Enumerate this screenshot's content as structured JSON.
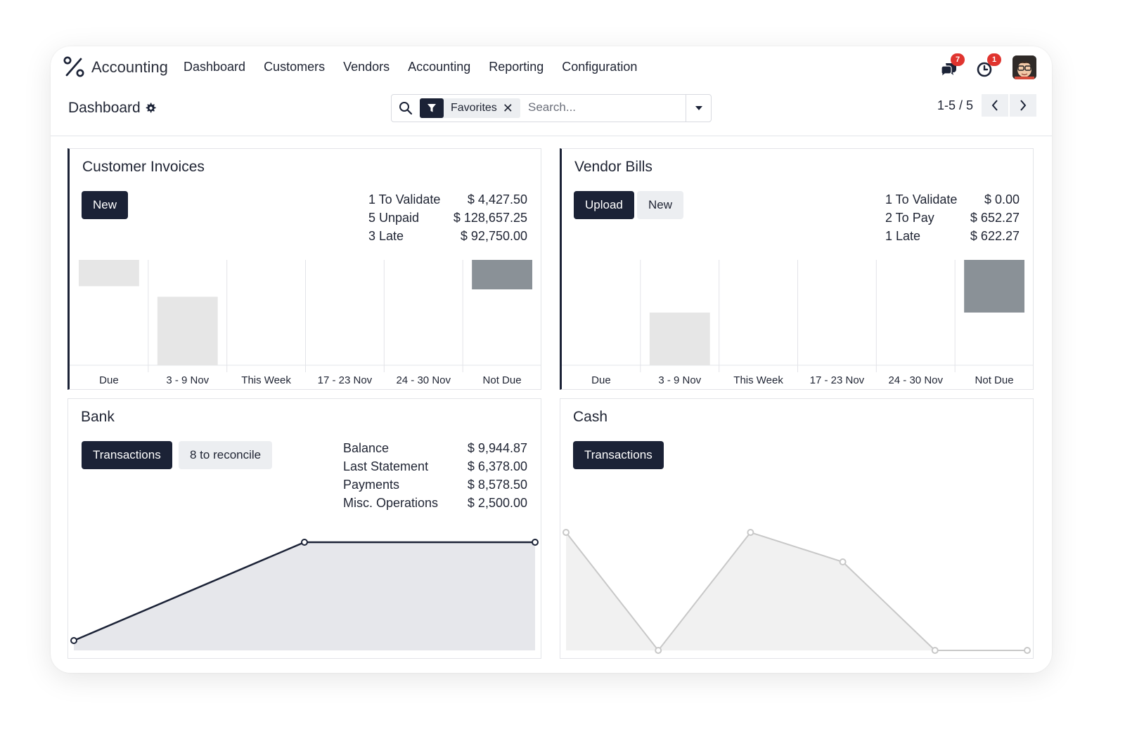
{
  "app": {
    "name": "Accounting",
    "menu": [
      "Dashboard",
      "Customers",
      "Vendors",
      "Accounting",
      "Reporting",
      "Configuration"
    ],
    "messages_badge": "7",
    "activities_badge": "1"
  },
  "control": {
    "breadcrumb": "Dashboard",
    "facet_label": "Favorites",
    "facet_remove": "✕",
    "search_placeholder": "Search...",
    "pager": "1-5 / 5"
  },
  "customer_invoices": {
    "title": "Customer Invoices",
    "buttons": {
      "new": "New"
    },
    "stats": [
      {
        "label": "1 To Validate",
        "value": "$ 4,427.50"
      },
      {
        "label": "5 Unpaid",
        "value": "$ 128,657.25"
      },
      {
        "label": "3 Late",
        "value": "$ 92,750.00"
      }
    ]
  },
  "vendor_bills": {
    "title": "Vendor Bills",
    "buttons": {
      "upload": "Upload",
      "new": "New"
    },
    "stats": [
      {
        "label": "1 To Validate",
        "value": "$ 0.00"
      },
      {
        "label": "2 To Pay",
        "value": "$ 652.27"
      },
      {
        "label": "1 Late",
        "value": "$ 622.27"
      }
    ]
  },
  "bank": {
    "title": "Bank",
    "buttons": {
      "transactions": "Transactions",
      "reconcile": "8 to reconcile"
    },
    "stats": [
      {
        "label": "Balance",
        "value": "$ 9,944.87"
      },
      {
        "label": "Last Statement",
        "value": "$ 6,378.00"
      },
      {
        "label": "Payments",
        "value": "$ 8,578.50"
      },
      {
        "label": "Misc. Operations",
        "value": "$ 2,500.00"
      }
    ]
  },
  "cash": {
    "title": "Cash",
    "buttons": {
      "transactions": "Transactions"
    }
  },
  "colors": {
    "primary": "#1b2236",
    "past_bar": "#e6e6e6",
    "future_bar": "#8a9197",
    "badge": "#e0342f",
    "bank_line": "#1b2236",
    "bank_fill": "#e6e7eb",
    "cash_line": "#c8c8c8",
    "cash_fill": "#f1f1f1"
  },
  "chart_data": [
    {
      "id": "customer_invoices",
      "type": "bar",
      "categories": [
        "Due",
        "3 - 9 Nov",
        "This Week",
        "17 - 23 Nov",
        "24 - 30 Nov",
        "Not Due"
      ],
      "ranges": [
        [
          0.75,
          1.0
        ],
        [
          0,
          0.65
        ],
        null,
        null,
        null,
        [
          0.72,
          1.0
        ]
      ],
      "kinds": [
        "past",
        "past",
        null,
        null,
        null,
        "future"
      ]
    },
    {
      "id": "vendor_bills",
      "type": "bar",
      "categories": [
        "Due",
        "3 - 9 Nov",
        "This Week",
        "17 - 23 Nov",
        "24 - 30 Nov",
        "Not Due"
      ],
      "ranges": [
        null,
        [
          0,
          0.5
        ],
        null,
        null,
        null,
        [
          0.5,
          1.0
        ]
      ],
      "kinds": [
        null,
        "past",
        null,
        null,
        null,
        "future"
      ]
    },
    {
      "id": "bank",
      "type": "area",
      "x": [
        0,
        1,
        2
      ],
      "values": [
        0,
        1,
        1
      ],
      "ylim": [
        -0.1,
        1.1
      ]
    },
    {
      "id": "cash",
      "type": "area",
      "x": [
        0,
        1,
        2,
        3,
        4,
        5
      ],
      "values": [
        1,
        0,
        1,
        0.75,
        0,
        0
      ],
      "ylim": [
        0,
        1
      ]
    }
  ]
}
